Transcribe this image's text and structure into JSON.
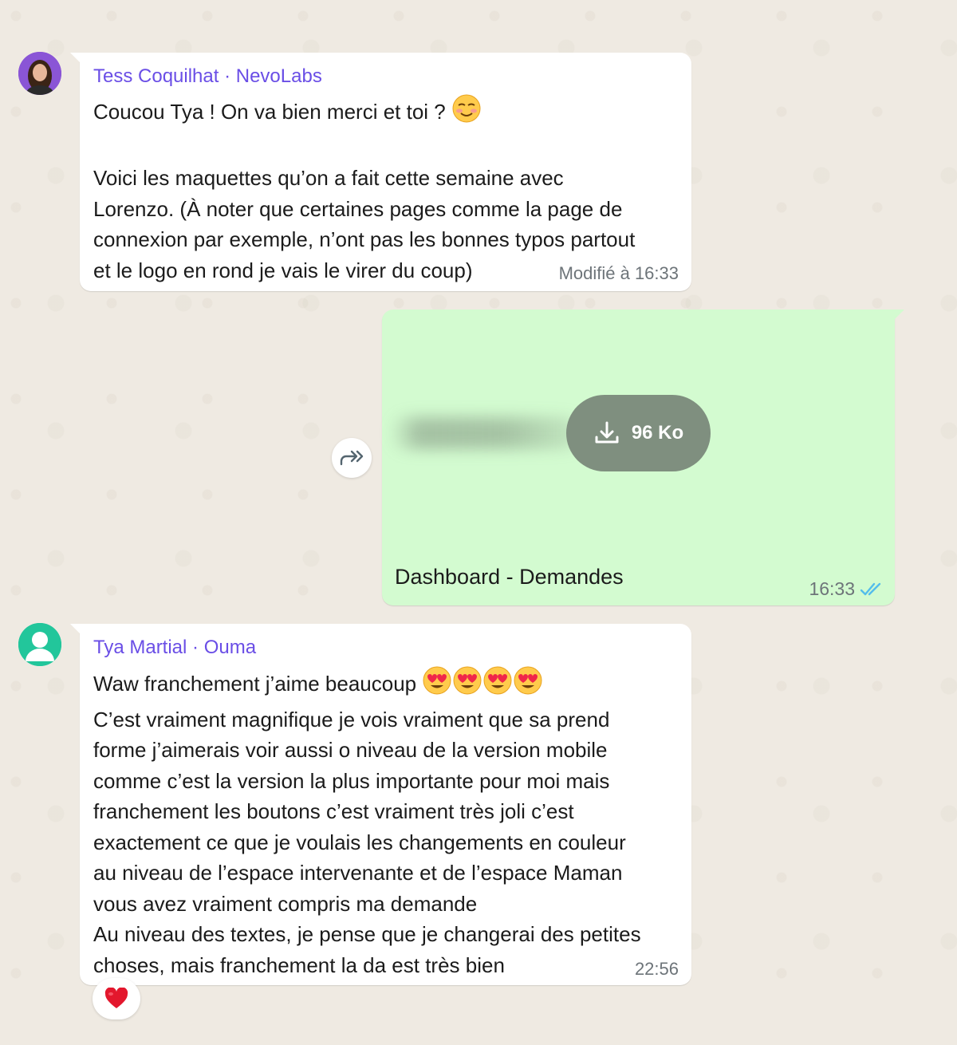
{
  "messages": [
    {
      "sender": "Tess Coquilhat · NevoLabs",
      "lines": [
        "Coucou Tya ! On va bien merci et toi ?",
        "",
        "Voici les maquettes qu’on a fait cette semaine avec",
        "Lorenzo. (À noter que certaines pages comme la page de",
        "connexion par exemple, n’ont pas les bonnes typos partout",
        "et le logo en rond je vais le virer du coup)"
      ],
      "trailing_emoji": "smiling-blushing-emoji",
      "meta": "Modifié à 16:33"
    },
    {
      "file_size": "96 Ko",
      "caption": "Dashboard - Demandes",
      "time": "16:33",
      "status_icon": "double-check-read-icon"
    },
    {
      "sender": "Tya Martial · Ouma",
      "lines": [
        "Waw franchement j’aime beaucoup",
        "C’est vraiment magnifique je vois vraiment que sa prend",
        "forme j’aimerais voir aussi o niveau de la version mobile",
        "comme c’est la version la plus importante pour moi mais",
        "franchement les boutons c’est vraiment très joli c’est",
        "exactement ce que je voulais les changements en couleur",
        "au niveau de l’espace intervenante et de l’espace Maman",
        "vous avez vraiment compris ma demande",
        "Au niveau des textes, je pense que je changerai des petites",
        "choses, mais franchement la da est très bien"
      ],
      "trailing_emojis": [
        "heart-eyes-emoji",
        "heart-eyes-emoji",
        "heart-eyes-emoji",
        "heart-eyes-emoji"
      ],
      "time": "22:56",
      "reaction": "red-heart-emoji"
    }
  ],
  "colors": {
    "background": "#efeae2",
    "incoming_bubble": "#ffffff",
    "outgoing_bubble": "#d3fbd0",
    "sender_name": "#6a4ee6",
    "read_ticks": "#53bdeb",
    "download_pill": "#7f8f7f"
  }
}
